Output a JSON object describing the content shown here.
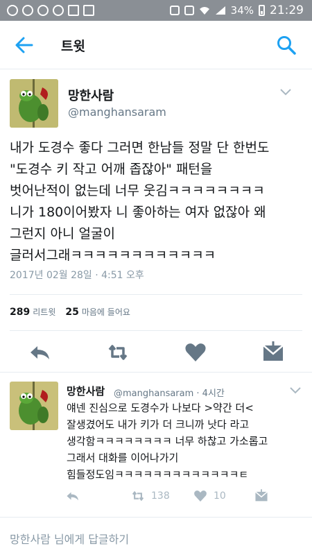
{
  "status_bar": {
    "battery_percent": "34%",
    "time": "21:29"
  },
  "app_bar": {
    "title": "트윗"
  },
  "tweet": {
    "author_name": "망한사람",
    "author_handle": "@manghansaram",
    "text_lines": [
      "내가 도경수 좋다 그러면 한남들 정말 단 한번도",
      "\"도경수 키 작고 어깨 좁잖아\" 패턴을",
      "벗어난적이 없는데 너무 웃김ㅋㅋㅋㅋㅋㅋㅋㅋ",
      "니가 180이어봤자 니 좋아하는 여자 없잖아 왜",
      "그런지 아니 얼굴이",
      "글러서그래ㅋㅋㅋㅋㅋㅋㅋㅋㅋㅋㅋㅋ"
    ],
    "timestamp": "2017년 02월 28일 · 4:51 오후",
    "retweet_count": "289",
    "retweet_label": "리트윗",
    "like_count": "25",
    "like_label": "마음에 들어요"
  },
  "reply": {
    "author_name": "망한사람",
    "author_handle_time": "@manghansaram · 4시간",
    "text_lines": [
      "얘넨 진심으로 도경수가 나보다 >약간 더<",
      "잘생겼어도 내가 키가 더 크니까 낫다 라고",
      "생각함ㅋㅋㅋㅋㅋㅋㅋㅋ 너무 하찮고 가소롭고",
      "그래서 대화를 이어나가기",
      "힘들정도임ㅋㅋㅋㅋㅋㅋㅋㅋㅋㅋㅋㅋㅋㅌ"
    ],
    "retweet_count": "138",
    "like_count": "10"
  },
  "reply_bar": {
    "placeholder": "망한사람 님에게 답글하기"
  },
  "colors": {
    "accent": "#1da1f2",
    "icon_gray": "#657786",
    "light_icon": "#aab8c2",
    "statusbar": "#8a8f95"
  },
  "icons": [
    "back-arrow-icon",
    "search-icon",
    "reply-icon",
    "retweet-icon",
    "heart-icon",
    "dm-icon",
    "chevron-down-icon"
  ]
}
